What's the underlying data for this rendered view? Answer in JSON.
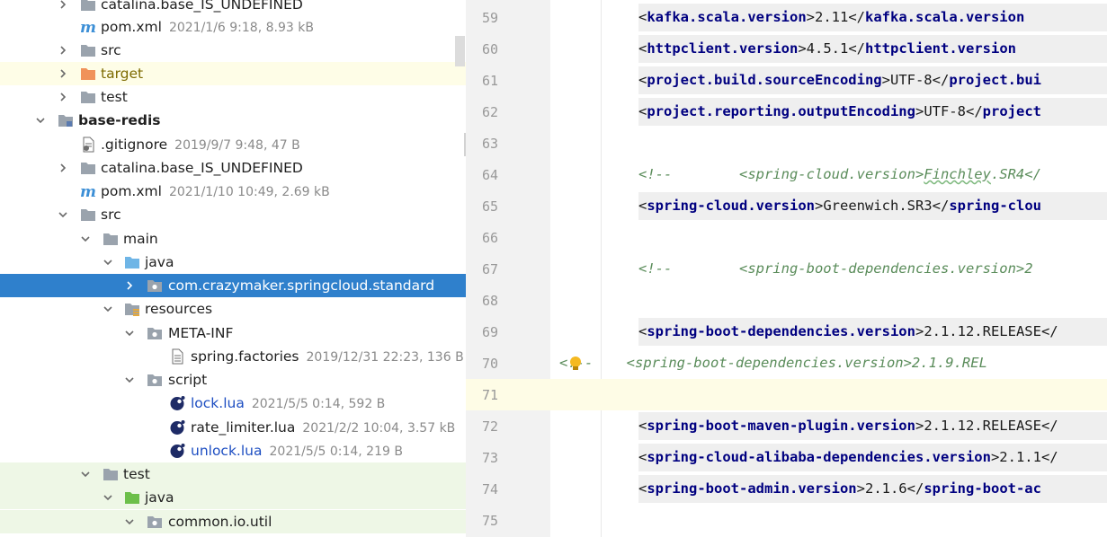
{
  "tree": {
    "rows": [
      {
        "label": "catalina.base_IS_UNDEFINED",
        "meta": "",
        "icon": "folder-icon",
        "arrow": "right"
      },
      {
        "label": "pom.xml",
        "meta": "2021/1/6 9:18, 8.93 kB",
        "icon": "maven-icon",
        "arrow": ""
      },
      {
        "label": "src",
        "meta": "",
        "icon": "folder-icon",
        "arrow": "right"
      },
      {
        "label": "target",
        "meta": "",
        "icon": "excluded-folder-icon",
        "arrow": "right"
      },
      {
        "label": "test",
        "meta": "",
        "icon": "folder-icon",
        "arrow": "right"
      },
      {
        "label": "base-redis",
        "meta": "",
        "icon": "module-icon",
        "arrow": "down"
      },
      {
        "label": ".gitignore",
        "meta": "2019/9/7 9:48, 47 B",
        "icon": "ignore-file-icon",
        "arrow": ""
      },
      {
        "label": "catalina.base_IS_UNDEFINED",
        "meta": "",
        "icon": "folder-icon",
        "arrow": "right"
      },
      {
        "label": "pom.xml",
        "meta": "2021/1/10 10:49, 2.69 kB",
        "icon": "maven-icon",
        "arrow": ""
      },
      {
        "label": "src",
        "meta": "",
        "icon": "folder-icon",
        "arrow": "down"
      },
      {
        "label": "main",
        "meta": "",
        "icon": "folder-icon",
        "arrow": "down"
      },
      {
        "label": "java",
        "meta": "",
        "icon": "source-folder-icon",
        "arrow": "down"
      },
      {
        "label": "com.crazymaker.springcloud.standard",
        "meta": "",
        "icon": "package-icon",
        "arrow": "right"
      },
      {
        "label": "resources",
        "meta": "",
        "icon": "resources-folder-icon",
        "arrow": "down"
      },
      {
        "label": "META-INF",
        "meta": "",
        "icon": "package-icon",
        "arrow": "down"
      },
      {
        "label": "spring.factories",
        "meta": "2019/12/31 22:23, 136 B",
        "icon": "text-file-icon",
        "arrow": ""
      },
      {
        "label": "script",
        "meta": "",
        "icon": "package-icon",
        "arrow": "down"
      },
      {
        "label": "lock.lua",
        "meta": "2021/5/5 0:14, 592 B",
        "icon": "lua-icon",
        "arrow": ""
      },
      {
        "label": "rate_limiter.lua",
        "meta": "2021/2/2 10:04, 3.57 kB",
        "icon": "lua-icon",
        "arrow": ""
      },
      {
        "label": "unlock.lua",
        "meta": "2021/5/5 0:14, 219 B",
        "icon": "lua-icon",
        "arrow": ""
      },
      {
        "label": "test",
        "meta": "",
        "icon": "folder-icon",
        "arrow": "down"
      },
      {
        "label": "java",
        "meta": "",
        "icon": "test-source-folder-icon",
        "arrow": "down"
      },
      {
        "label": "common.io.util",
        "meta": "",
        "icon": "package-icon",
        "arrow": "down"
      }
    ]
  },
  "editor": {
    "lines": [
      {
        "num": "59",
        "open": "kafka.scala.version",
        "value": "2.11",
        "close": "kafka.scala.version"
      },
      {
        "num": "60",
        "open": "httpclient.version",
        "value": "4.5.1",
        "close": "httpclient.version"
      },
      {
        "num": "61",
        "open": "project.build.sourceEncoding",
        "value": "UTF-8",
        "close": "project.bui"
      },
      {
        "num": "62",
        "open": "project.reporting.outputEncoding",
        "value": "UTF-8",
        "close": "project"
      },
      {
        "num": "63"
      },
      {
        "num": "64",
        "comment": "<!--        <spring-cloud.version>",
        "squiggle": "Finchley",
        "comment_tail": ".SR4</"
      },
      {
        "num": "65",
        "open": "spring-cloud.version",
        "value": "Greenwich.SR3",
        "close": "spring-clou"
      },
      {
        "num": "66"
      },
      {
        "num": "67",
        "comment": "<!--        <spring-boot-dependencies.version>2"
      },
      {
        "num": "68"
      },
      {
        "num": "69",
        "open": "spring-boot-dependencies.version",
        "value": "2.1.12.RELEASE",
        "close": ""
      },
      {
        "num": "70",
        "comment": "<!--    <spring-boot-dependencies.version>2.1.9.REL"
      },
      {
        "num": "71"
      },
      {
        "num": "72",
        "open": "spring-boot-maven-plugin.version",
        "value": "2.1.12.RELEASE",
        "close": ""
      },
      {
        "num": "73",
        "open": "spring-cloud-alibaba-dependencies.version",
        "value": "2.1.1",
        "close": ""
      },
      {
        "num": "74",
        "open": "spring-boot-admin.version",
        "value": "2.1.6",
        "close": "spring-boot-ac"
      },
      {
        "num": "75"
      }
    ]
  }
}
